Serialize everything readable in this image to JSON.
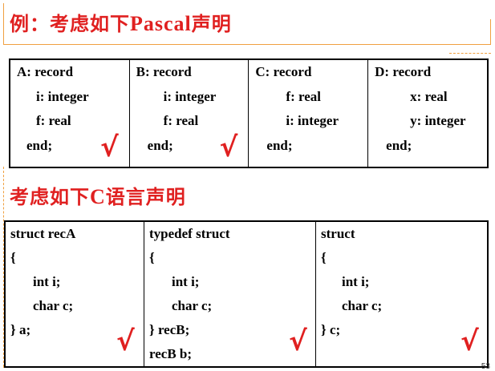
{
  "title": {
    "prefix": "例：考虑如下",
    "latin": "Pascal",
    "suffix": "声明"
  },
  "pascal_records": [
    {
      "lines": [
        "A: record",
        "i: integer",
        "f: real",
        "end;"
      ],
      "checked": true
    },
    {
      "lines": [
        "B: record",
        "i: integer",
        "f: real",
        "end;"
      ],
      "checked": true
    },
    {
      "lines": [
        "C: record",
        "f: real",
        "i: integer",
        "end;"
      ],
      "checked": false
    },
    {
      "lines": [
        "D: record",
        "x: real",
        "y: integer",
        "end;"
      ],
      "checked": false
    }
  ],
  "subtitle": {
    "prefix": "考虑如下",
    "latin": "C",
    "suffix": "语言声明"
  },
  "c_structs": [
    {
      "lines": [
        "struct recA",
        "{",
        "int i;",
        "char c;",
        "} a;"
      ],
      "checked": true
    },
    {
      "lines": [
        "typedef struct",
        "{",
        "int i;",
        "char c;",
        "} recB;",
        "recB b;"
      ],
      "checked": true
    },
    {
      "lines": [
        "struct",
        "{",
        "int i;",
        "char c;",
        "} c;"
      ],
      "checked": true
    }
  ],
  "check_mark": "√",
  "page_number": "53",
  "colors": {
    "accent_red": "#e02020",
    "frame_orange": "#f0a040"
  }
}
